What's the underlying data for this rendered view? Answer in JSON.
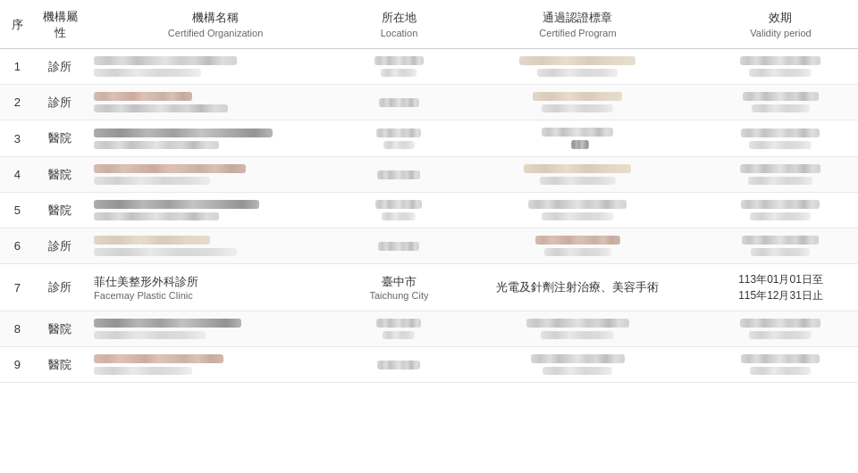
{
  "table": {
    "headers": [
      {
        "zh": "序",
        "en": "",
        "key": "seq"
      },
      {
        "zh": "機構屬性",
        "en": "",
        "key": "type"
      },
      {
        "zh": "機構名稱",
        "en": "Certified Organization",
        "key": "name"
      },
      {
        "zh": "所在地",
        "en": "Location",
        "key": "location"
      },
      {
        "zh": "通過認證標章",
        "en": "Certified Program",
        "key": "program"
      },
      {
        "zh": "效期",
        "en": "Validity period",
        "key": "validity"
      }
    ],
    "rows": [
      {
        "seq": "1",
        "type": "診所",
        "name_zh": "",
        "name_en": "",
        "location": "",
        "program": "",
        "validity": "",
        "visible": false
      },
      {
        "seq": "2",
        "type": "診所",
        "name_zh": "",
        "name_en": "",
        "location": "",
        "program": "",
        "validity": "",
        "visible": false
      },
      {
        "seq": "3",
        "type": "醫院",
        "name_zh": "",
        "name_en": "",
        "location": "",
        "program": "",
        "validity": "",
        "visible": false
      },
      {
        "seq": "4",
        "type": "醫院",
        "name_zh": "",
        "name_en": "",
        "location": "",
        "program": "",
        "validity": "",
        "visible": false
      },
      {
        "seq": "5",
        "type": "醫院",
        "name_zh": "",
        "name_en": "",
        "location": "",
        "program": "",
        "validity": "",
        "visible": false
      },
      {
        "seq": "6",
        "type": "診所",
        "name_zh": "",
        "name_en": "",
        "location": "",
        "program": "",
        "validity": "",
        "visible": false
      },
      {
        "seq": "7",
        "type": "診所",
        "name_zh": "菲仕美整形外科診所",
        "name_en": "Facemay Plastic Clinic",
        "location_zh": "臺中市",
        "location_en": "Taichung City",
        "program": "光電及針劑注射治療、美容手術",
        "validity": "113年01月01日至\n115年12月31日止",
        "visible": true
      },
      {
        "seq": "8",
        "type": "醫院",
        "name_zh": "",
        "name_en": "",
        "location": "",
        "program": "",
        "validity": "",
        "visible": false
      },
      {
        "seq": "9",
        "type": "醫院",
        "name_zh": "",
        "name_en": "",
        "location": "",
        "program": "",
        "validity": "",
        "visible": false
      }
    ]
  }
}
